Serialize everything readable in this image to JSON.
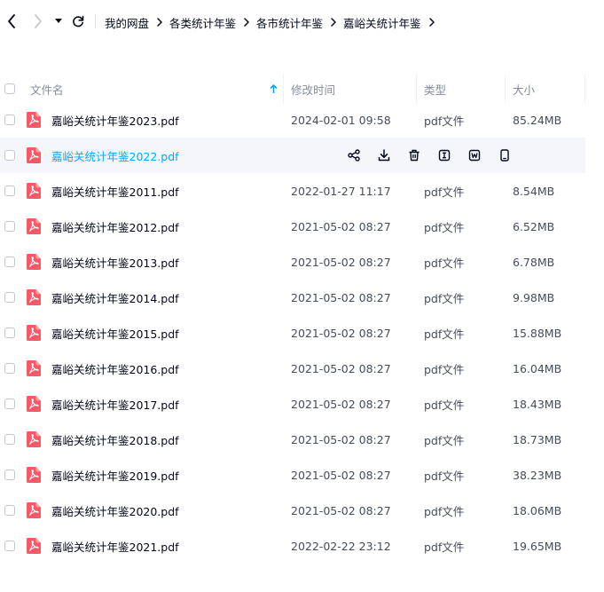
{
  "breadcrumbs": [
    "我的网盘",
    "各类统计年鉴",
    "各市统计年鉴",
    "嘉峪关统计年鉴"
  ],
  "columns": {
    "name": "文件名",
    "time": "修改时间",
    "type": "类型",
    "size": "大小"
  },
  "files": [
    {
      "name": "嘉峪关统计年鉴2023.pdf",
      "time": "2024-02-01 09:58",
      "type": "pdf文件",
      "size": "85.24MB"
    },
    {
      "name": "嘉峪关统计年鉴2022.pdf",
      "time": "",
      "type": "",
      "size": "",
      "hovered": true
    },
    {
      "name": "嘉峪关统计年鉴2011.pdf",
      "time": "2022-01-27 11:17",
      "type": "pdf文件",
      "size": "8.54MB"
    },
    {
      "name": "嘉峪关统计年鉴2012.pdf",
      "time": "2021-05-02 08:27",
      "type": "pdf文件",
      "size": "6.52MB"
    },
    {
      "name": "嘉峪关统计年鉴2013.pdf",
      "time": "2021-05-02 08:27",
      "type": "pdf文件",
      "size": "6.78MB"
    },
    {
      "name": "嘉峪关统计年鉴2014.pdf",
      "time": "2021-05-02 08:27",
      "type": "pdf文件",
      "size": "9.98MB"
    },
    {
      "name": "嘉峪关统计年鉴2015.pdf",
      "time": "2021-05-02 08:27",
      "type": "pdf文件",
      "size": "15.88MB"
    },
    {
      "name": "嘉峪关统计年鉴2016.pdf",
      "time": "2021-05-02 08:27",
      "type": "pdf文件",
      "size": "16.04MB"
    },
    {
      "name": "嘉峪关统计年鉴2017.pdf",
      "time": "2021-05-02 08:27",
      "type": "pdf文件",
      "size": "18.43MB"
    },
    {
      "name": "嘉峪关统计年鉴2018.pdf",
      "time": "2021-05-02 08:27",
      "type": "pdf文件",
      "size": "18.73MB"
    },
    {
      "name": "嘉峪关统计年鉴2019.pdf",
      "time": "2021-05-02 08:27",
      "type": "pdf文件",
      "size": "38.23MB"
    },
    {
      "name": "嘉峪关统计年鉴2020.pdf",
      "time": "2021-05-02 08:27",
      "type": "pdf文件",
      "size": "18.06MB"
    },
    {
      "name": "嘉峪关统计年鉴2021.pdf",
      "time": "2022-02-22 23:12",
      "type": "pdf文件",
      "size": "19.65MB"
    }
  ],
  "hover_actions": [
    "share-icon",
    "download-icon",
    "delete-icon",
    "rename-icon",
    "word-convert-icon",
    "phone-icon"
  ],
  "colors": {
    "accent": "#06a7ff",
    "pdf": "#f45a66",
    "hover_bg": "#f5f6fa"
  }
}
